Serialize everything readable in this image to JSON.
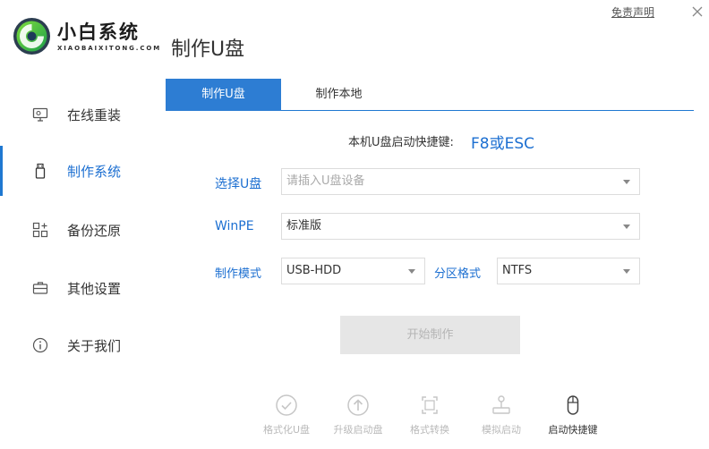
{
  "app": {
    "brand_title": "小白系统",
    "brand_subtitle": "XIAOBAIXITONG.COM",
    "page_title": "制作U盘",
    "disclaimer": "免责声明"
  },
  "sidebar": {
    "items": [
      {
        "label": "在线重装",
        "icon": "monitor-icon"
      },
      {
        "label": "制作系统",
        "icon": "usb-drive-icon",
        "active": true
      },
      {
        "label": "备份还原",
        "icon": "grid-icon"
      },
      {
        "label": "其他设置",
        "icon": "briefcase-icon"
      },
      {
        "label": "关于我们",
        "icon": "info-icon"
      }
    ]
  },
  "tabs": [
    {
      "label": "制作U盘",
      "active": true
    },
    {
      "label": "制作本地",
      "active": false
    }
  ],
  "hotkey": {
    "label": "本机U盘启动快捷键:",
    "value": "F8或ESC"
  },
  "form": {
    "usb": {
      "label": "选择U盘",
      "placeholder": "请插入U盘设备"
    },
    "winpe": {
      "label": "WinPE",
      "value": "标准版"
    },
    "mode": {
      "label": "制作模式",
      "value": "USB-HDD"
    },
    "partition": {
      "label": "分区格式",
      "value": "NTFS"
    }
  },
  "start_button": "开始制作",
  "tools": [
    {
      "label": "格式化U盘",
      "icon": "check-circle-icon"
    },
    {
      "label": "升级启动盘",
      "icon": "upload-circle-icon"
    },
    {
      "label": "格式转换",
      "icon": "convert-icon"
    },
    {
      "label": "模拟启动",
      "icon": "joystick-icon"
    },
    {
      "label": "启动快捷键",
      "icon": "mouse-icon",
      "active": true
    }
  ],
  "colors": {
    "accent": "#1f78d1",
    "disabled_button": "#e6e6e6"
  }
}
